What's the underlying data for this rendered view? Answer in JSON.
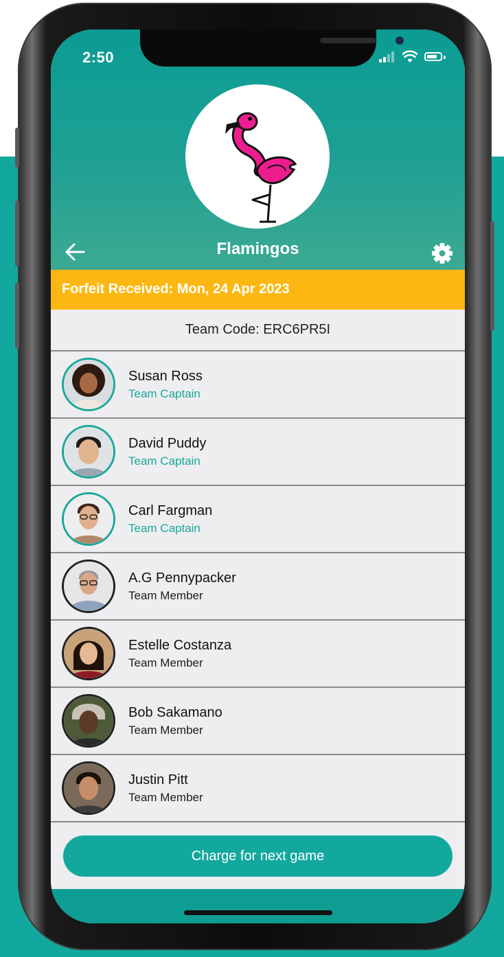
{
  "status_bar": {
    "time": "2:50"
  },
  "header": {
    "title": "Flamingos",
    "logo_icon": "flamingo-icon"
  },
  "banner": {
    "text": "Forfeit Received: Mon, 24 Apr 2023",
    "color": "#fdb713"
  },
  "team_code": "Team Code: ERC6PR5I",
  "members": [
    {
      "name": "Susan Ross",
      "role": "Team Captain",
      "is_captain": true
    },
    {
      "name": "David Puddy",
      "role": "Team Captain",
      "is_captain": true
    },
    {
      "name": "Carl Fargman",
      "role": "Team Captain",
      "is_captain": true
    },
    {
      "name": "A.G Pennypacker",
      "role": "Team Member",
      "is_captain": false
    },
    {
      "name": "Estelle Costanza",
      "role": "Team Member",
      "is_captain": false
    },
    {
      "name": "Bob Sakamano",
      "role": "Team Member",
      "is_captain": false
    },
    {
      "name": "Justin Pitt",
      "role": "Team Member",
      "is_captain": false
    }
  ],
  "actions": {
    "charge_label": "Charge for next game"
  },
  "colors": {
    "accent": "#13a89e",
    "banner": "#fdb713",
    "captain": "#1aa89a"
  }
}
